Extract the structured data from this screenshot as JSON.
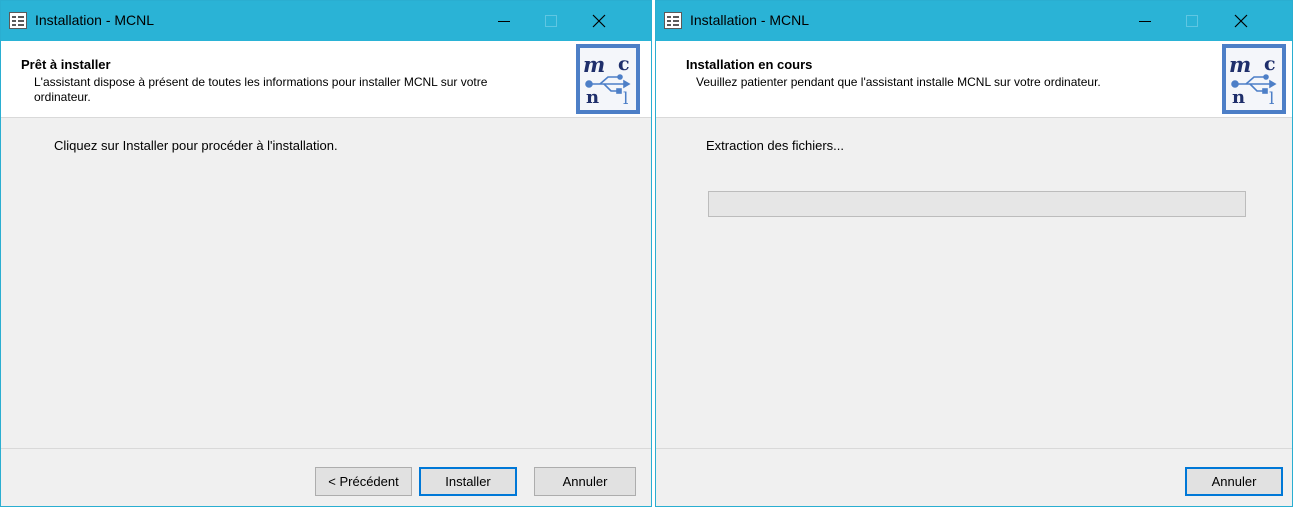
{
  "windows": [
    {
      "title": "Installation - MCNL",
      "header": {
        "title": "Prêt à installer",
        "description": "L'assistant dispose à présent de toutes les informations pour installer MCNL sur votre ordinateur."
      },
      "content_text": "Cliquez sur Installer pour procéder à l'installation.",
      "buttons": {
        "back": "< Précédent",
        "install": "Installer",
        "cancel": "Annuler"
      }
    },
    {
      "title": "Installation - MCNL",
      "header": {
        "title": "Installation en cours",
        "description": "Veuillez patienter pendant que l'assistant installe MCNL sur votre ordinateur."
      },
      "status_text": "Extraction des fichiers...",
      "progress_fraction": 0.0,
      "buttons": {
        "cancel": "Annuler"
      }
    }
  ],
  "logo": {
    "letters": [
      "m",
      "c",
      "n",
      "l"
    ],
    "icon": "usb-icon"
  },
  "colors": {
    "titlebar": "#2ab3d6",
    "header_bg": "#ffffff",
    "body_bg": "#f0f0f0",
    "logo_border": "#4d7fc7",
    "default_button_border": "#0078d7"
  }
}
